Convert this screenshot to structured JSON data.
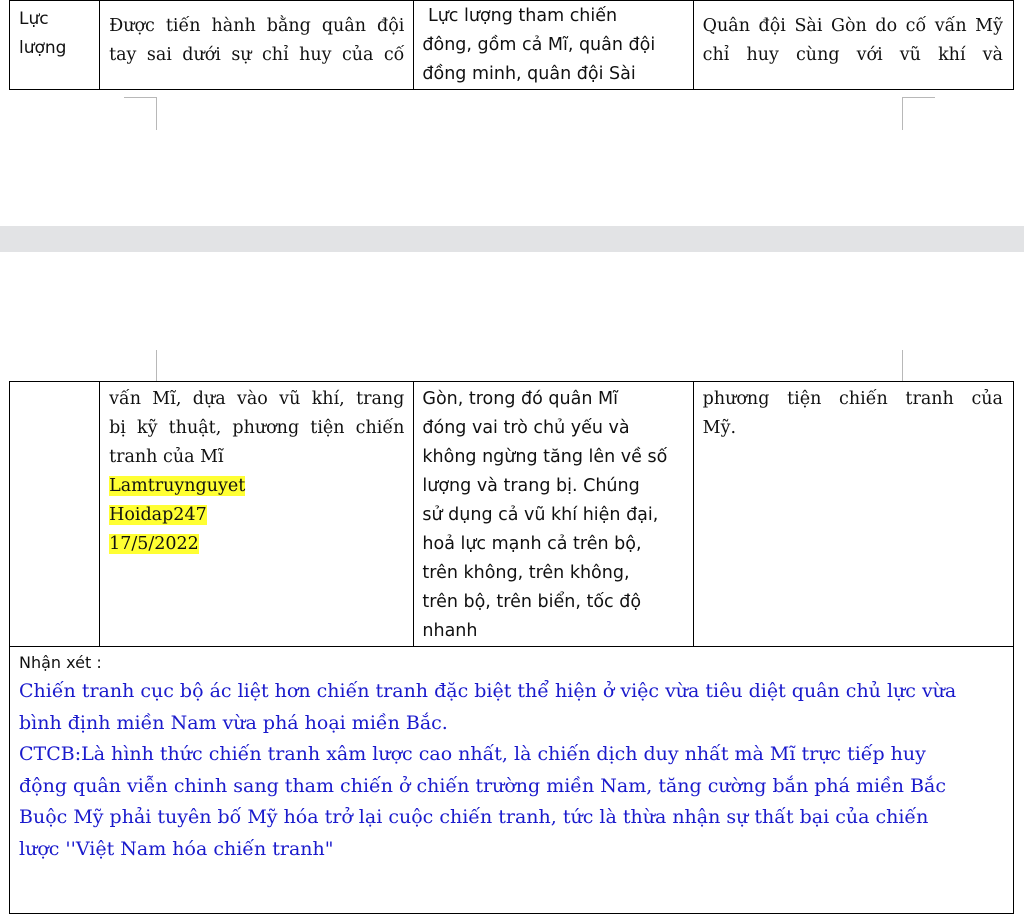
{
  "page1": {
    "col1": [
      "Lực",
      "lượng"
    ],
    "col2": [
      "Được tiến hành bằng quân đội",
      "tay sai dưới sự chỉ huy của cố"
    ],
    "col3": [
      " Lực lượng tham chiến",
      "đông, gồm cả Mĩ, quân đội",
      "đồng minh, quân đội Sài"
    ],
    "col4": [
      "Quân đội Sài Gòn do cố vấn Mỹ",
      "chỉ huy cùng với vũ khí và"
    ]
  },
  "page2": {
    "col2": [
      "vấn Mĩ, dựa vào vũ khí, trang",
      "bị kỹ thuật, phương tiện chiến",
      "tranh của Mĩ"
    ],
    "highlight": [
      "Lamtruynguyet",
      "Hoidap247",
      "17/5/2022"
    ],
    "col3": [
      "Gòn, trong đó quân Mĩ",
      "đóng vai trò chủ yếu và",
      "không ngừng tăng lên về số",
      "lượng và trang bị. Chúng",
      "sử dụng cả vũ khí hiện đại,",
      "hoả lực mạnh cả trên bộ,",
      "trên không, trên không,",
      "trên bộ, trên biển, tốc độ",
      "nhanh"
    ],
    "col4": [
      "phương tiện chiến tranh của",
      "Mỹ."
    ],
    "note_heading": "Nhận xét :",
    "note_lines": [
      "Chiến tranh cục bộ ác liệt hơn chiến tranh đặc biệt thể hiện ở việc vừa tiêu diệt quân chủ lực vừa",
      "bình định miền Nam vừa phá hoại miền Bắc.",
      "CTCB:Là hình thức chiến tranh xâm lược cao nhất, là chiến dịch duy nhất mà Mĩ trực tiếp huy",
      "động quân viễn chinh sang tham chiến ở chiến trường miền Nam, tăng cường bắn phá miền Bắc",
      "Buộc Mỹ phải tuyên bố Mỹ hóa trở lại cuộc chiến tranh, tức là thừa nhận sự thất bại của chiến",
      "lược ''Việt Nam hóa chiến tranh\""
    ]
  },
  "colors": {
    "note_text": "#1a1acc",
    "highlight": "#ffff33",
    "page_gap": "#e2e3e5"
  }
}
